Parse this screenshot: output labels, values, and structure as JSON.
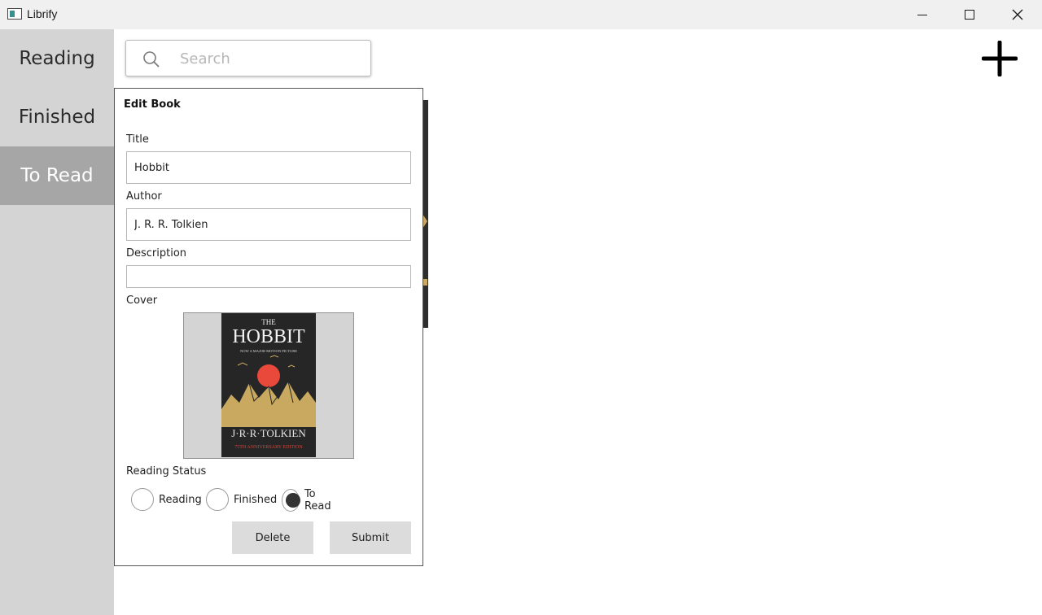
{
  "window": {
    "title": "Librify",
    "minimize_icon": "minimize-icon",
    "maximize_icon": "maximize-icon",
    "close_icon": "close-icon"
  },
  "sidebar": {
    "items": [
      {
        "label": "Reading",
        "active": false
      },
      {
        "label": "Finished",
        "active": false
      },
      {
        "label": "To Read",
        "active": true
      }
    ]
  },
  "search": {
    "placeholder": "Search",
    "value": "",
    "icon": "search-icon"
  },
  "add_button": {
    "icon": "plus-icon"
  },
  "dialog": {
    "title": "Edit Book",
    "title_label": "Title",
    "title_value": "Hobbit",
    "author_label": "Author",
    "author_value": "J. R. R. Tolkien",
    "description_label": "Description",
    "description_value": "",
    "cover_label": "Cover",
    "cover": {
      "line1": "THE",
      "line2": "HOBBIT",
      "line3": "NOW A MAJOR MOTION PICTURE",
      "author": "J·R·R·TOLKIEN",
      "edition": "75TH ANNIVERSARY EDITION"
    },
    "status_label": "Reading Status",
    "status_options": [
      {
        "label": "Reading",
        "checked": false
      },
      {
        "label": "Finished",
        "checked": false
      },
      {
        "label": "To Read",
        "checked": true
      }
    ],
    "delete_label": "Delete",
    "submit_label": "Submit"
  },
  "colors": {
    "sidebar_bg": "#d4d4d4",
    "sidebar_active_bg": "#a6a6a6",
    "button_bg": "#dcdcdc",
    "cover_sun": "#e8493a",
    "cover_mountains": "#c9a860"
  }
}
